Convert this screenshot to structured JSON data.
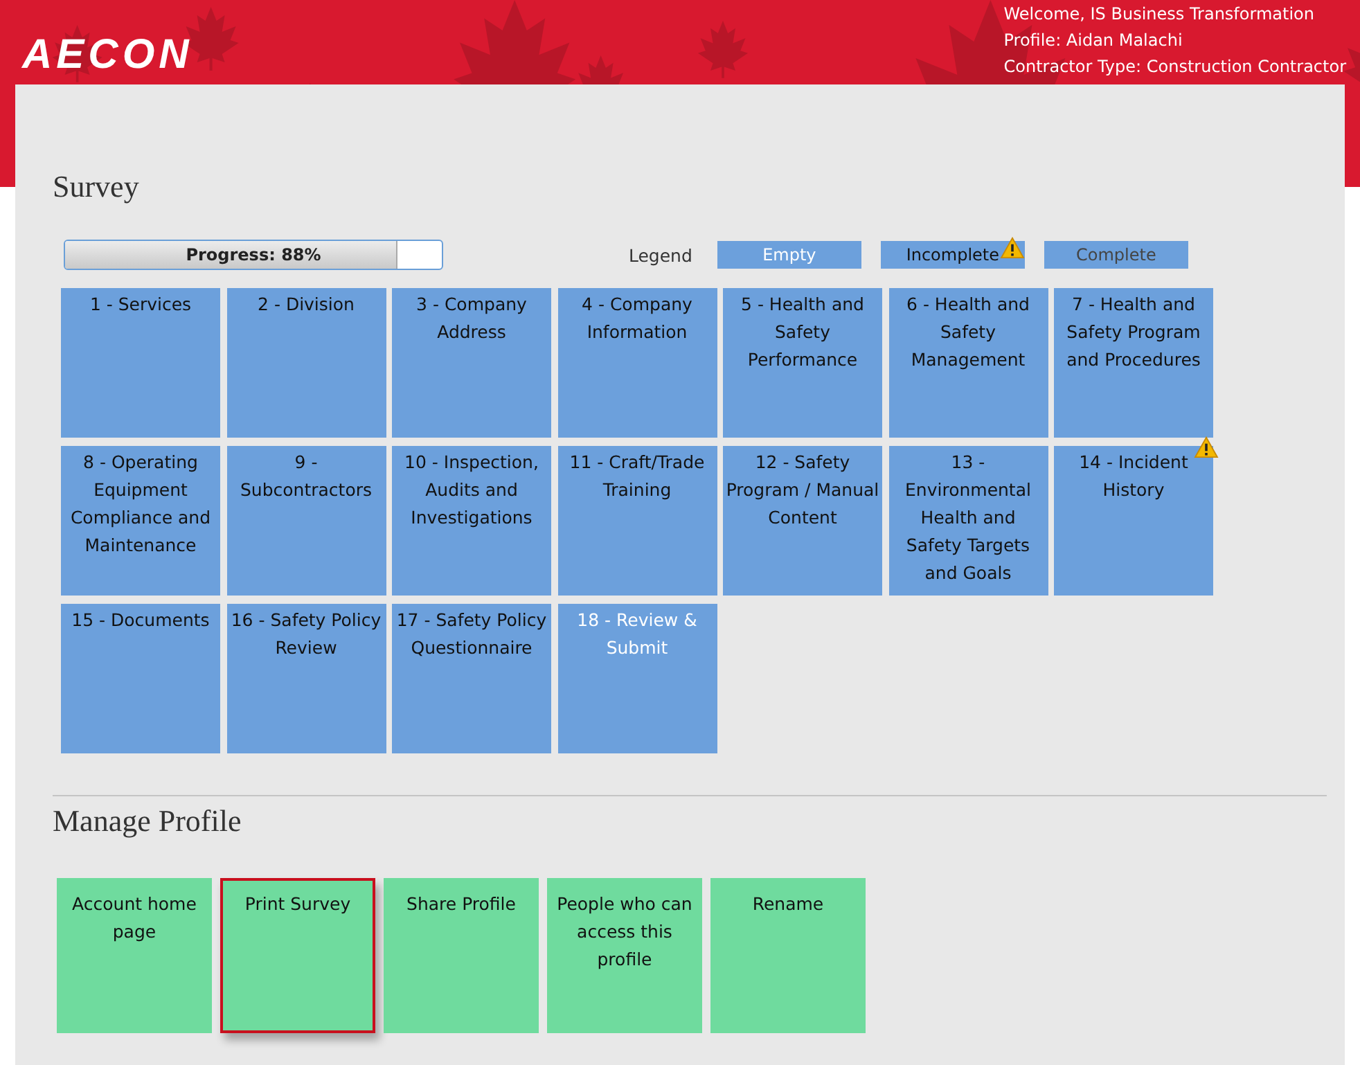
{
  "header": {
    "logo": "AECON",
    "welcome": "Welcome, IS Business Transformation",
    "profile": "Profile: Aidan Malachi",
    "contractor_type": "Contractor Type: Construction Contractor"
  },
  "survey": {
    "title": "Survey",
    "progress": {
      "label": "Progress: 88%",
      "level": 0.88
    },
    "legend": {
      "label": "Legend",
      "items": [
        {
          "label": "Empty",
          "kind": "empty"
        },
        {
          "label": "Incomplete",
          "kind": "incomplete"
        },
        {
          "label": "Complete",
          "kind": "complete"
        }
      ]
    },
    "sections": [
      {
        "label": "1 - Services",
        "kind": "complete"
      },
      {
        "label": "2 - Division",
        "kind": "complete"
      },
      {
        "label": "3 - Company Address",
        "kind": "complete"
      },
      {
        "label": "4 - Company Information",
        "kind": "complete"
      },
      {
        "label": "5 - Health and Safety Performance",
        "kind": "complete"
      },
      {
        "label": "6 - Health and Safety Management",
        "kind": "complete"
      },
      {
        "label": "7 - Health and Safety Program and Procedures",
        "kind": "complete"
      },
      {
        "label": "8 - Operating Equipment Compliance and Maintenance",
        "kind": "complete"
      },
      {
        "label": "9 - Subcontractors",
        "kind": "complete"
      },
      {
        "label": "10 - Inspection, Audits and Investigations",
        "kind": "complete"
      },
      {
        "label": "11 - Craft/Trade Training",
        "kind": "complete"
      },
      {
        "label": "12 - Safety Program / Manual Content",
        "kind": "complete"
      },
      {
        "label": "13 - Environmental Health and Safety Targets and Goals",
        "kind": "complete"
      },
      {
        "label": "14 - Incident History",
        "kind": "incomplete"
      },
      {
        "label": "15 - Documents",
        "kind": "complete"
      },
      {
        "label": "16 - Safety Policy Review",
        "kind": "complete"
      },
      {
        "label": "17 - Safety Policy Questionnaire",
        "kind": "complete"
      },
      {
        "label": "18 - Review & Submit",
        "kind": "empty"
      }
    ]
  },
  "manage_profile": {
    "title": "Manage Profile",
    "actions": [
      {
        "label": "Account home page",
        "selected": false
      },
      {
        "label": "Print Survey",
        "selected": true
      },
      {
        "label": "Share Profile",
        "selected": false
      },
      {
        "label": "People who can access this profile",
        "selected": false
      },
      {
        "label": "Rename",
        "selected": false
      }
    ]
  }
}
